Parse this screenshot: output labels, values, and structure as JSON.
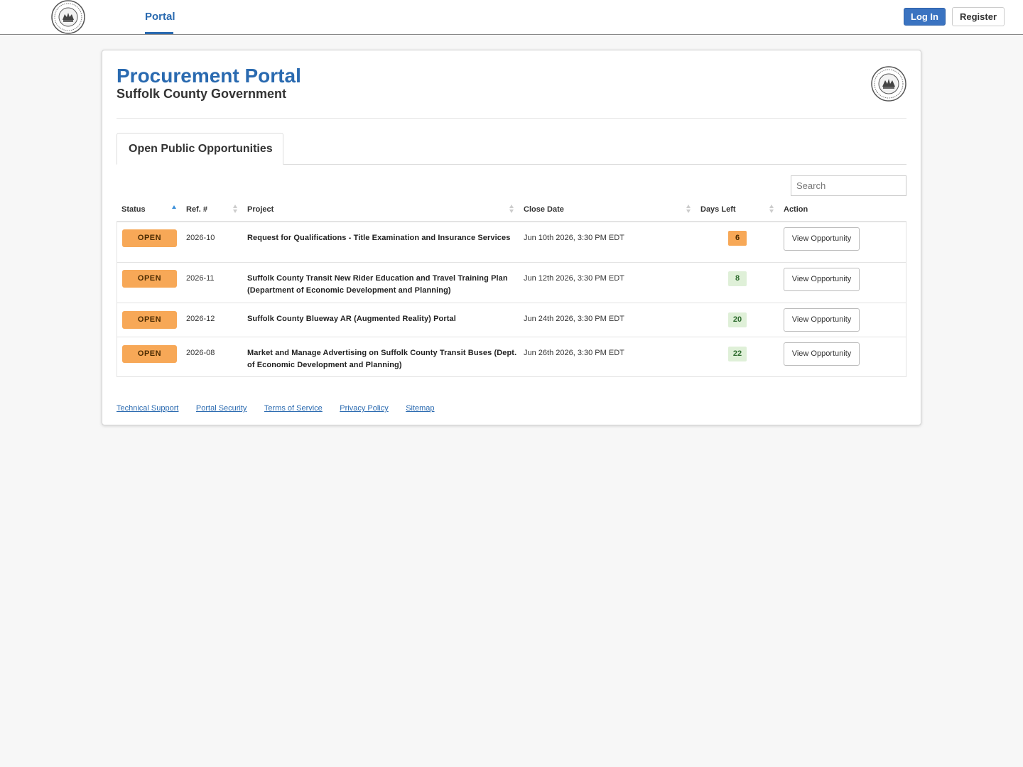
{
  "nav": {
    "tab_portal": "Portal",
    "login_label": "Log In",
    "register_label": "Register"
  },
  "header": {
    "title": "Procurement Portal",
    "subtitle": "Suffolk County Government"
  },
  "tabs": {
    "active_label": "Open Public Opportunities"
  },
  "search": {
    "placeholder": "Search"
  },
  "table": {
    "columns": [
      "Status",
      "Ref. #",
      "Project",
      "Close Date",
      "Days Left",
      "Action"
    ],
    "rows": [
      {
        "status": "OPEN",
        "ref": "2026-10",
        "project": "Request for Qualifications - Title Examination and Insurance Services",
        "close_date": "Jun 10th 2026, 3:30 PM EDT",
        "days_left": "6",
        "action": "View Opportunity"
      },
      {
        "status": "OPEN",
        "ref": "2026-11",
        "project": "Suffolk County Transit New Rider Education and Travel Training Plan (Department of Economic Development and Planning)",
        "close_date": "Jun 12th 2026, 3:30 PM EDT",
        "days_left": "8",
        "action": "View Opportunity"
      },
      {
        "status": "OPEN",
        "ref": "2026-12",
        "project": "Suffolk County Blueway AR (Augmented Reality) Portal",
        "close_date": "Jun 24th 2026, 3:30 PM EDT",
        "days_left": "20",
        "action": "View Opportunity"
      },
      {
        "status": "OPEN",
        "ref": "2026-08",
        "project": "Market and Manage Advertising on Suffolk County Transit Buses (Dept. of Economic Development and Planning)",
        "close_date": "Jun 26th 2026, 3:30 PM EDT",
        "days_left": "22",
        "action": "View Opportunity"
      }
    ]
  },
  "footer": {
    "links": [
      "Technical Support",
      "Portal Security",
      "Terms of Service",
      "Privacy Policy",
      "Sitemap"
    ]
  },
  "colors": {
    "brand_blue": "#2a6ab0",
    "status_open": "#f7a857",
    "days_warn": "#f7a857",
    "days_ok": "#dff0d8"
  },
  "icons": {
    "logo": "county-seal-icon",
    "sort_asc": "sort-asc-icon",
    "sort_both": "sort-both-icon"
  }
}
